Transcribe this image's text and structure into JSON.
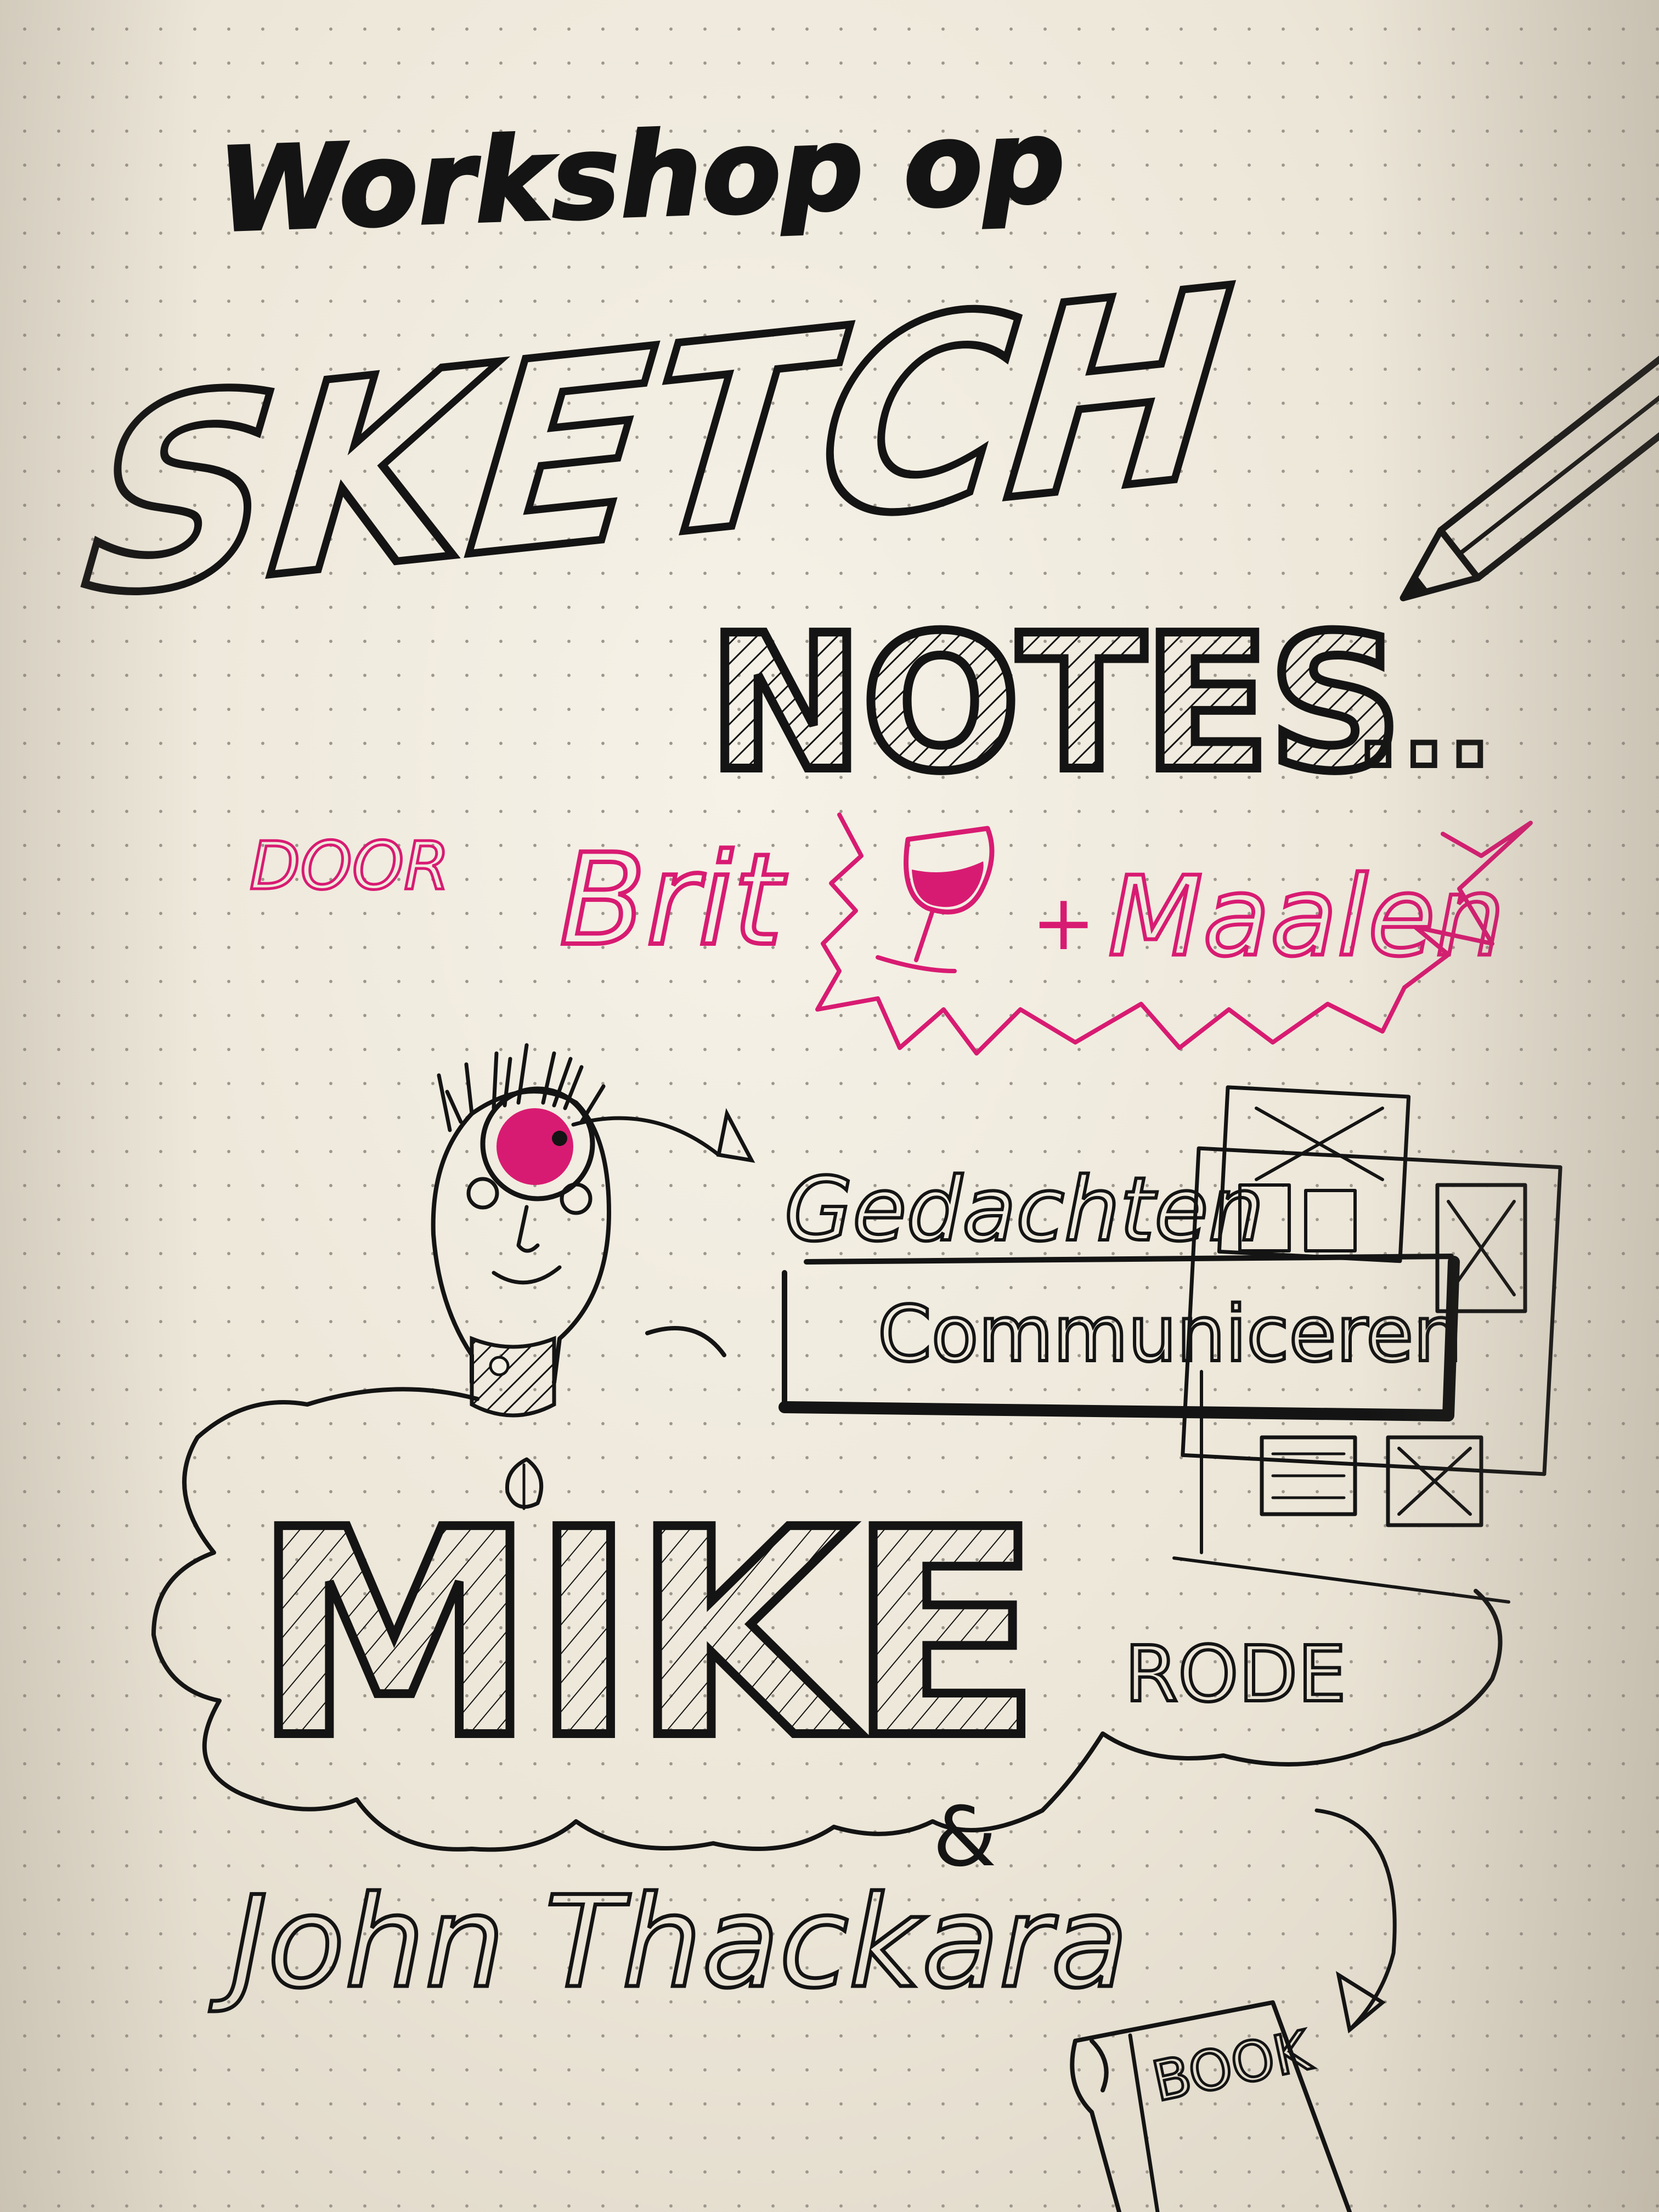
{
  "title": {
    "line1": "Workshop op",
    "line2": "SKETCH",
    "line3": "NOTES...",
    "line3_main": "NOTES",
    "line3_tail": "..."
  },
  "byline": {
    "door": "DOOR",
    "name1": "Brit",
    "plus": "+",
    "name2": "Maalen"
  },
  "labels": {
    "gedachten": "Gedachten",
    "communiceren": "Communiceren",
    "mike": "MIKE",
    "rode": "RODE",
    "ampersand": "&",
    "john": "John Thackara",
    "book": "BOOK"
  },
  "colors": {
    "ink": "#141414",
    "accent_pink": "#d81b72",
    "paper": "#f3efe5"
  },
  "icons": [
    "pencil-icon",
    "wine-glass-icon",
    "eye-head-icon",
    "wireframe-pages-icon",
    "book-icon",
    "cloud-icon"
  ]
}
